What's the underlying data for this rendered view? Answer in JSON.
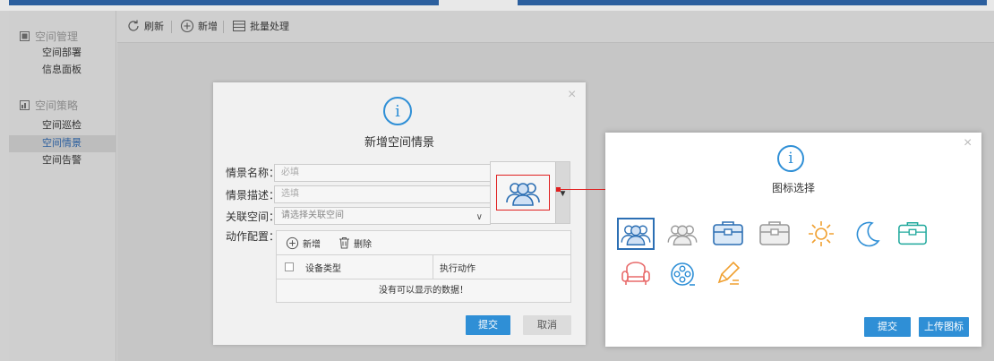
{
  "sidebar": {
    "groups": [
      {
        "label": "空间管理",
        "items": [
          "空间部署",
          "信息面板"
        ]
      },
      {
        "label": "空间策略",
        "items": [
          "空间巡检",
          "空间情景",
          "空间告警"
        ]
      }
    ],
    "active_item": "空间情景"
  },
  "toolbar": {
    "refresh_label": "刷新",
    "add_label": "新增",
    "batch_label": "批量处理"
  },
  "scene_dialog": {
    "title": "新增空间情景",
    "fields": {
      "name_label": "情景名称：",
      "name_placeholder": "必填",
      "desc_label": "情景描述：",
      "desc_placeholder": "选填",
      "space_label": "关联空间：",
      "space_placeholder": "请选择关联空间",
      "action_label": "动作配置："
    },
    "action_panel": {
      "add_label": "新增",
      "delete_label": "删除",
      "columns": [
        "设备类型",
        "执行动作"
      ],
      "empty_text": "没有可以显示的数据！"
    },
    "submit_label": "提交",
    "cancel_label": "取消"
  },
  "icon_dialog": {
    "title": "图标选择",
    "icons": [
      {
        "name": "users-blue-icon",
        "selected": true
      },
      {
        "name": "users-gray-icon",
        "selected": false
      },
      {
        "name": "briefcase-blue-icon",
        "selected": false
      },
      {
        "name": "briefcase-gray-icon",
        "selected": false
      },
      {
        "name": "sun-icon",
        "selected": false
      },
      {
        "name": "moon-icon",
        "selected": false
      },
      {
        "name": "briefcase-teal-icon",
        "selected": false
      },
      {
        "name": "armchair-icon",
        "selected": false
      },
      {
        "name": "film-reel-icon",
        "selected": false
      },
      {
        "name": "pencil-edit-icon",
        "selected": false
      }
    ],
    "submit_label": "提交",
    "upload_label": "上传图标"
  },
  "colors": {
    "primary": "#2f8fd6",
    "brand": "#2c5f9e",
    "highlight": "#e02020",
    "selected_text": "#2c5f9e"
  }
}
